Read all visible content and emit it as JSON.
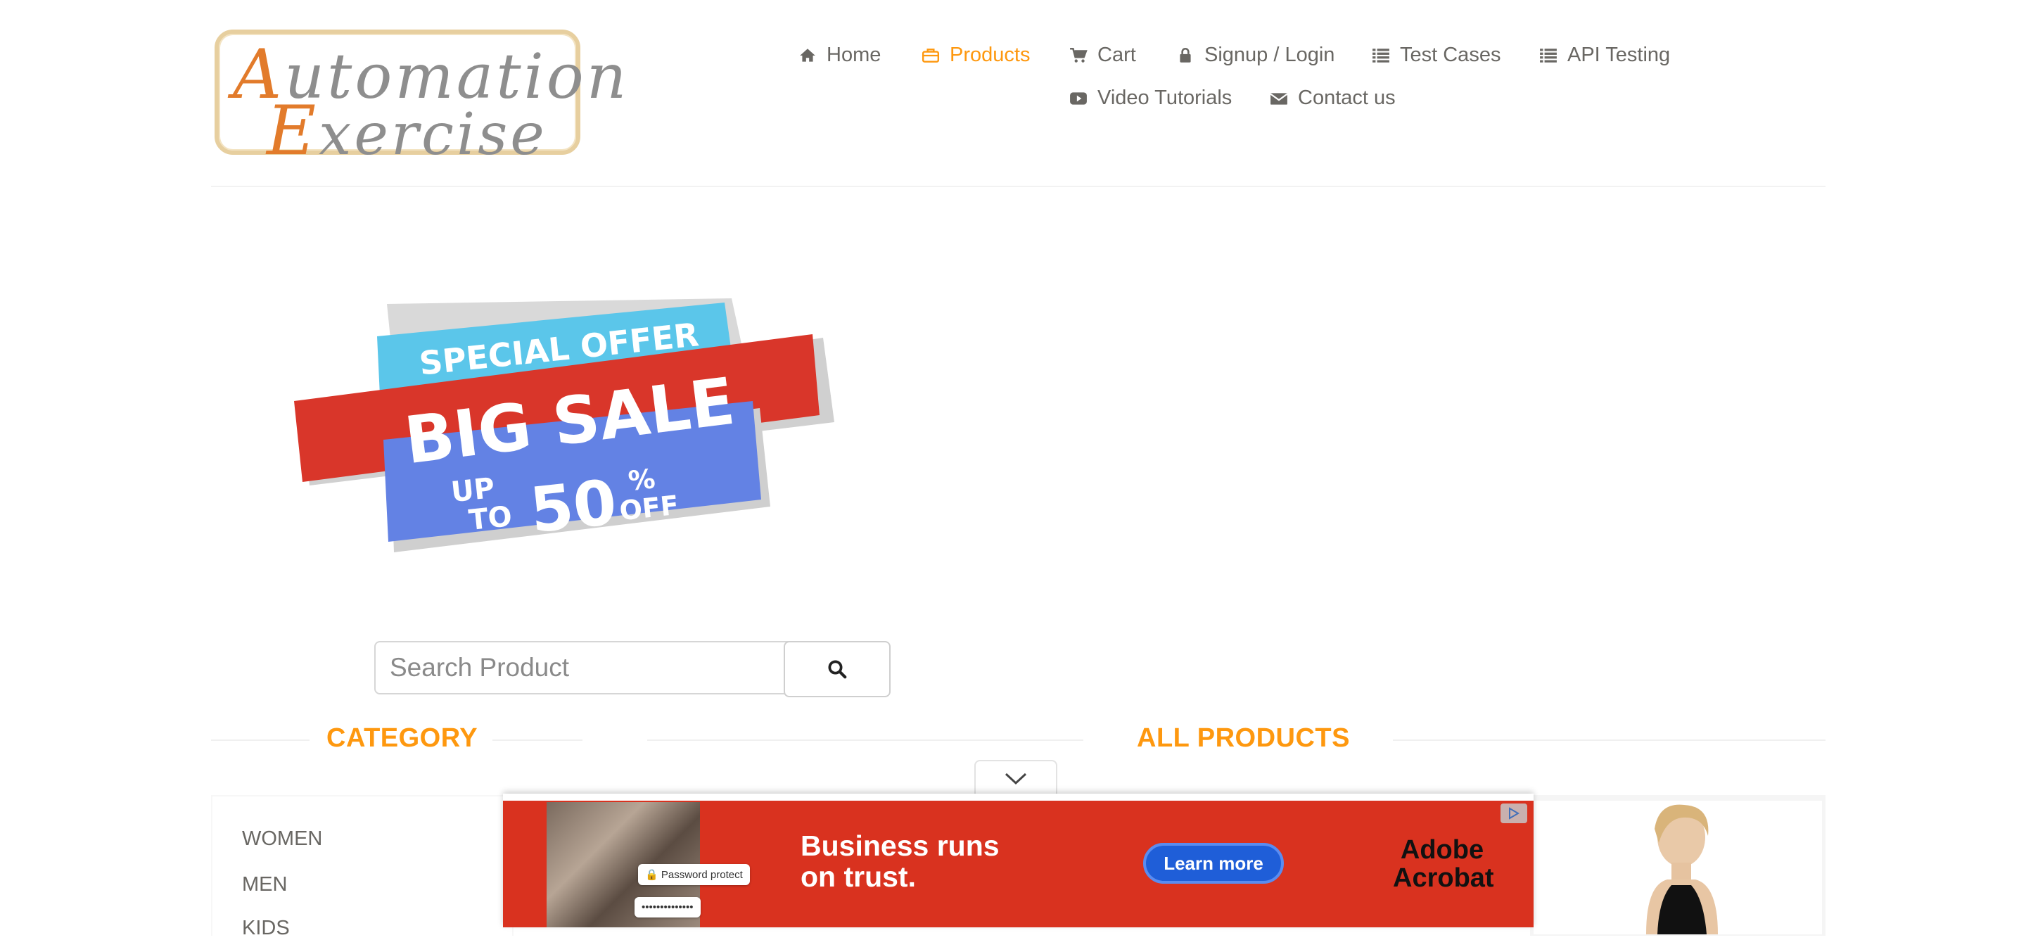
{
  "logo": {
    "line1_cap": "A",
    "line1_rest": "utomation",
    "line2_cap": "E",
    "line2_rest": "xercise"
  },
  "nav": {
    "items": [
      {
        "label": "Home",
        "icon": "home-icon"
      },
      {
        "label": "Products",
        "icon": "briefcase-icon",
        "active": true
      },
      {
        "label": "Cart",
        "icon": "cart-icon"
      },
      {
        "label": "Signup / Login",
        "icon": "lock-icon"
      },
      {
        "label": "Test Cases",
        "icon": "list-icon"
      },
      {
        "label": "API Testing",
        "icon": "list-icon"
      },
      {
        "label": "Video Tutorials",
        "icon": "youtube-play-icon"
      },
      {
        "label": "Contact us",
        "icon": "envelope-icon"
      }
    ]
  },
  "sale_banner": {
    "line1": "SPECIAL OFFER",
    "line2": "BIG SALE",
    "up": "UP",
    "to": "TO",
    "percent_value": "50",
    "percent_sign": "%",
    "off": "OFF"
  },
  "search": {
    "placeholder": "Search Product",
    "button_icon": "search-icon"
  },
  "sections": {
    "category_title": "CATEGORY",
    "products_title": "ALL PRODUCTS"
  },
  "categories": [
    "WOMEN",
    "MEN",
    "KIDS"
  ],
  "ad": {
    "chip1": "Password protect",
    "chip2": "••••••••••••••",
    "headline_line1": "Business runs",
    "headline_line2": "on trust.",
    "cta": "Learn more",
    "brand_line1": "Adobe",
    "brand_line2": "Acrobat",
    "collapse_icon": "chevron-down-icon",
    "adchoices_icon": "adchoices-icon"
  },
  "colors": {
    "accent": "#FE980F",
    "text": "#696763",
    "ad_bg": "#d9321f",
    "ad_cta": "#1f5ed8"
  }
}
